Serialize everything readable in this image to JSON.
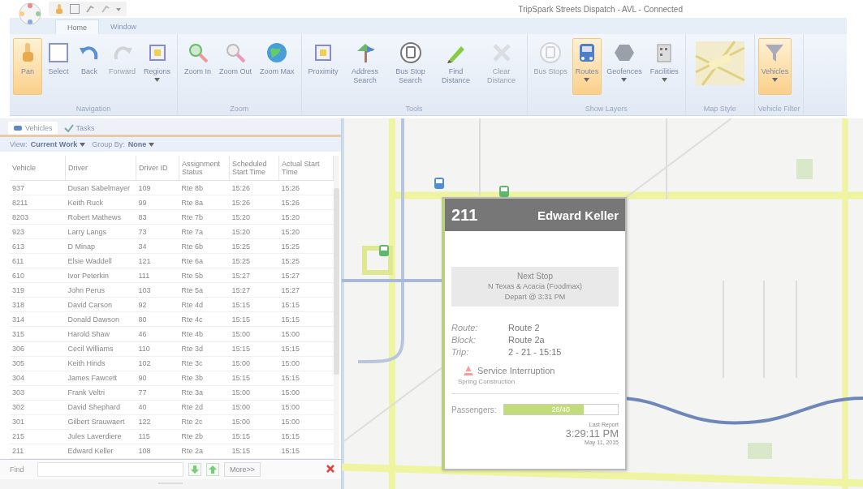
{
  "window": {
    "title": "TripSpark Streets Dispatch - AVL - Connected"
  },
  "ribbon_tabs": [
    {
      "label": "Home",
      "selected": true
    },
    {
      "label": "Window",
      "selected": false
    }
  ],
  "ribbon_groups": [
    {
      "label": "Navigation",
      "buttons": [
        {
          "label": "Pan",
          "selected": true,
          "disabled": false,
          "dropdown": false
        },
        {
          "label": "Select",
          "selected": false,
          "disabled": false,
          "dropdown": false
        },
        {
          "label": "Back",
          "selected": false,
          "disabled": false,
          "dropdown": false
        },
        {
          "label": "Forward",
          "selected": false,
          "disabled": true,
          "dropdown": false
        },
        {
          "label": "Regions",
          "selected": false,
          "disabled": false,
          "dropdown": true
        }
      ]
    },
    {
      "label": "Zoom",
      "buttons": [
        {
          "label": "Zoom In",
          "selected": false,
          "disabled": false,
          "dropdown": false
        },
        {
          "label": "Zoom Out",
          "selected": false,
          "disabled": false,
          "dropdown": false
        },
        {
          "label": "Zoom Max",
          "selected": false,
          "disabled": false,
          "dropdown": false
        }
      ]
    },
    {
      "label": "Tools",
      "buttons": [
        {
          "label": "Proximity",
          "selected": false,
          "disabled": false,
          "dropdown": false
        },
        {
          "label": "Address Search",
          "selected": false,
          "disabled": false,
          "dropdown": false
        },
        {
          "label": "Bus Stop Search",
          "selected": false,
          "disabled": false,
          "dropdown": false
        },
        {
          "label": "Find Distance",
          "selected": false,
          "disabled": false,
          "dropdown": false
        },
        {
          "label": "Clear Distance",
          "selected": false,
          "disabled": true,
          "dropdown": false
        }
      ]
    },
    {
      "label": "Show Layers",
      "buttons": [
        {
          "label": "Bus Stops",
          "selected": false,
          "disabled": true,
          "dropdown": false
        },
        {
          "label": "Routes",
          "selected": true,
          "disabled": false,
          "dropdown": true
        },
        {
          "label": "Geofences",
          "selected": false,
          "disabled": false,
          "dropdown": true
        },
        {
          "label": "Facilities",
          "selected": false,
          "disabled": false,
          "dropdown": true
        }
      ]
    },
    {
      "label": "Map Style"
    },
    {
      "label": "Vehicle Filter",
      "buttons": [
        {
          "label": "Vehicles",
          "selected": true,
          "disabled": false,
          "dropdown": true
        }
      ]
    }
  ],
  "panel_tabs": [
    {
      "label": "Vehicles",
      "selected": true
    },
    {
      "label": "Tasks",
      "selected": false
    }
  ],
  "view_bar": {
    "view_label": "View:",
    "view_value": "Current Work",
    "group_label": "Group By:",
    "group_value": "None"
  },
  "table": {
    "columns": [
      "Vehicle",
      "Driver",
      "Driver ID",
      "Assignment Status",
      "Scheduled Start Time",
      "Actual Start Time"
    ],
    "rows": [
      [
        "937",
        "Dusan Sabelmayer",
        "109",
        "Rte 8b",
        "15:26",
        "15:26"
      ],
      [
        "8211",
        "Keith Ruck",
        "99",
        "Rte 8a",
        "15:26",
        "15:26"
      ],
      [
        "8203",
        "Robert Mathews",
        "83",
        "Rte 7b",
        "15:20",
        "15:20"
      ],
      [
        "923",
        "Larry Langs",
        "73",
        "Rte 7a",
        "15:20",
        "15:20"
      ],
      [
        "613",
        "D Minap",
        "34",
        "Rte 6b",
        "15:25",
        "15:25"
      ],
      [
        "611",
        "Elsie Waddell",
        "121",
        "Rte 6a",
        "15:25",
        "15:25"
      ],
      [
        "610",
        "Ivor Peterkin",
        "111",
        "Rte 5b",
        "15:27",
        "15:27"
      ],
      [
        "319",
        "John Perus",
        "103",
        "Rte 5a",
        "15:27",
        "15:27"
      ],
      [
        "318",
        "David Carson",
        "92",
        "Rte 4d",
        "15:15",
        "15:15"
      ],
      [
        "314",
        "Donald Dawson",
        "80",
        "Rte 4c",
        "15:15",
        "15:15"
      ],
      [
        "315",
        "Harold Shaw",
        "46",
        "Rte 4b",
        "15:00",
        "15:00"
      ],
      [
        "306",
        "Cecil Williams",
        "110",
        "Rte 3d",
        "15:15",
        "15:15"
      ],
      [
        "305",
        "Keith Hinds",
        "102",
        "Rte 3c",
        "15:00",
        "15:00"
      ],
      [
        "304",
        "James Fawcett",
        "90",
        "Rte 3b",
        "15:15",
        "15:15"
      ],
      [
        "303",
        "Frank Veltri",
        "77",
        "Rte 3a",
        "15:00",
        "15:00"
      ],
      [
        "302",
        "David Shephard",
        "40",
        "Rte 2d",
        "15:00",
        "15:00"
      ],
      [
        "301",
        "Gilbert Srauwaert",
        "122",
        "Rte 2c",
        "15:00",
        "15:00"
      ],
      [
        "215",
        "Jules Laverdiere",
        "115",
        "Rte 2b",
        "15:15",
        "15:15"
      ],
      [
        "211",
        "Edward Keller",
        "108",
        "Rte 2a",
        "15:15",
        "15:15"
      ]
    ]
  },
  "find_bar": {
    "label": "Find",
    "more_button": "More>>"
  },
  "popup": {
    "vehicle": "211",
    "driver": "Edward Keller",
    "next_stop_title": "Next Stop",
    "next_stop_name": "N Texas & Acacia (Foodmax)",
    "next_stop_depart": "Depart @ 3:31 PM",
    "details": [
      {
        "label": "Route:",
        "value": "Route 2"
      },
      {
        "label": "Block:",
        "value": "Route 2a"
      },
      {
        "label": "Trip:",
        "value": "2 - 21 - 15:15"
      }
    ],
    "interruption_title": "Service Interruption",
    "interruption_reason": "Spring Construction",
    "passengers_label": "Passengers:",
    "passengers": {
      "level": 0.7,
      "reading": "28/40"
    },
    "last_report_label": "Last Report",
    "last_report_time": "3:29:11 PM",
    "last_report_date": "May 11, 2015"
  }
}
